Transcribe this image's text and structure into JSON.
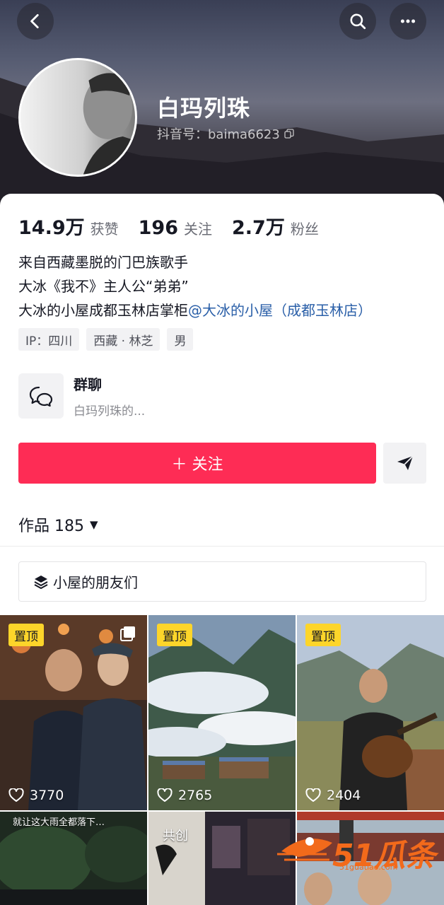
{
  "header": {
    "back_icon": "chevron-left-icon",
    "search_icon": "search-icon",
    "more_icon": "more-dots-icon"
  },
  "profile": {
    "name": "白玛列珠",
    "douyin_id": "抖音号：baima6623"
  },
  "stats": [
    {
      "value": "14.9万",
      "label": "获赞"
    },
    {
      "value": "196",
      "label": "关注"
    },
    {
      "value": "2.7万",
      "label": "粉丝"
    }
  ],
  "bio": {
    "line1": "来自西藏墨脱的门巴族歌手",
    "line2": "大冰《我不》主人公“弟弟”",
    "line3_prefix": "大冰的小屋成都玉林店掌柜",
    "line3_mention": "@大冰的小屋（成都玉林店）"
  },
  "tags": [
    "IP：四川",
    "西藏 · 林芝",
    "男"
  ],
  "group_chat": {
    "title": "群聊",
    "subtitle": "白玛列珠的..."
  },
  "actions": {
    "follow_label": "＋ 关注",
    "share_icon": "send-icon"
  },
  "works": {
    "label": "作品 185",
    "dropdown": "▼"
  },
  "collection": {
    "label": "小屋的朋友们"
  },
  "videos": [
    {
      "pinned": "置顶",
      "likes": "3770"
    },
    {
      "pinned": "置顶",
      "likes": "2765"
    },
    {
      "pinned": "置顶",
      "likes": "2404"
    },
    {
      "caption": "就让这大雨全都落下…"
    },
    {
      "caption": "共创"
    },
    {
      "caption": ""
    }
  ],
  "watermark": {
    "text": "51瓜条",
    "url": "51guatiao.com"
  },
  "colors": {
    "follow": "#fe2c55",
    "pin_badge": "#fdd52a",
    "mention": "#2a5fa8",
    "watermark": "#f26a1b"
  }
}
